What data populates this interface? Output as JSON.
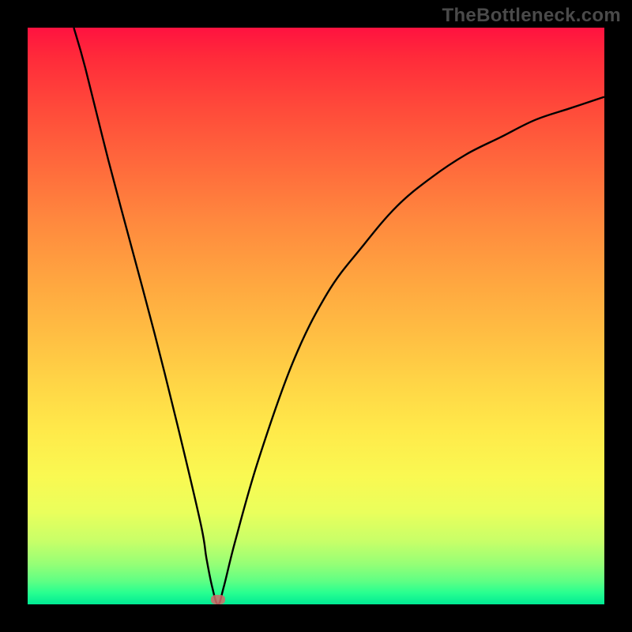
{
  "watermark": "TheBottleneck.com",
  "colors": {
    "background": "#000000",
    "gradient_top": "#ff1240",
    "gradient_bottom": "#00eb94",
    "curve": "#000000",
    "marker": "#d46a6a"
  },
  "chart_data": {
    "type": "line",
    "title": "",
    "xlabel": "",
    "ylabel": "",
    "xlim": [
      0,
      100
    ],
    "ylim": [
      0,
      100
    ],
    "annotations": [
      "TheBottleneck.com"
    ],
    "series": [
      {
        "name": "bottleneck_curve",
        "x": [
          8,
          10,
          14,
          18,
          22,
          26,
          30,
          31,
          32,
          33,
          34,
          36,
          40,
          46,
          52,
          58,
          64,
          70,
          76,
          82,
          88,
          94,
          100
        ],
        "y": [
          100,
          93,
          77,
          62,
          47,
          31,
          14,
          8,
          3,
          0,
          3,
          11,
          25,
          42,
          54,
          62,
          69,
          74,
          78,
          81,
          84,
          86,
          88
        ]
      }
    ],
    "marker": {
      "x": 33,
      "y": 0
    }
  }
}
